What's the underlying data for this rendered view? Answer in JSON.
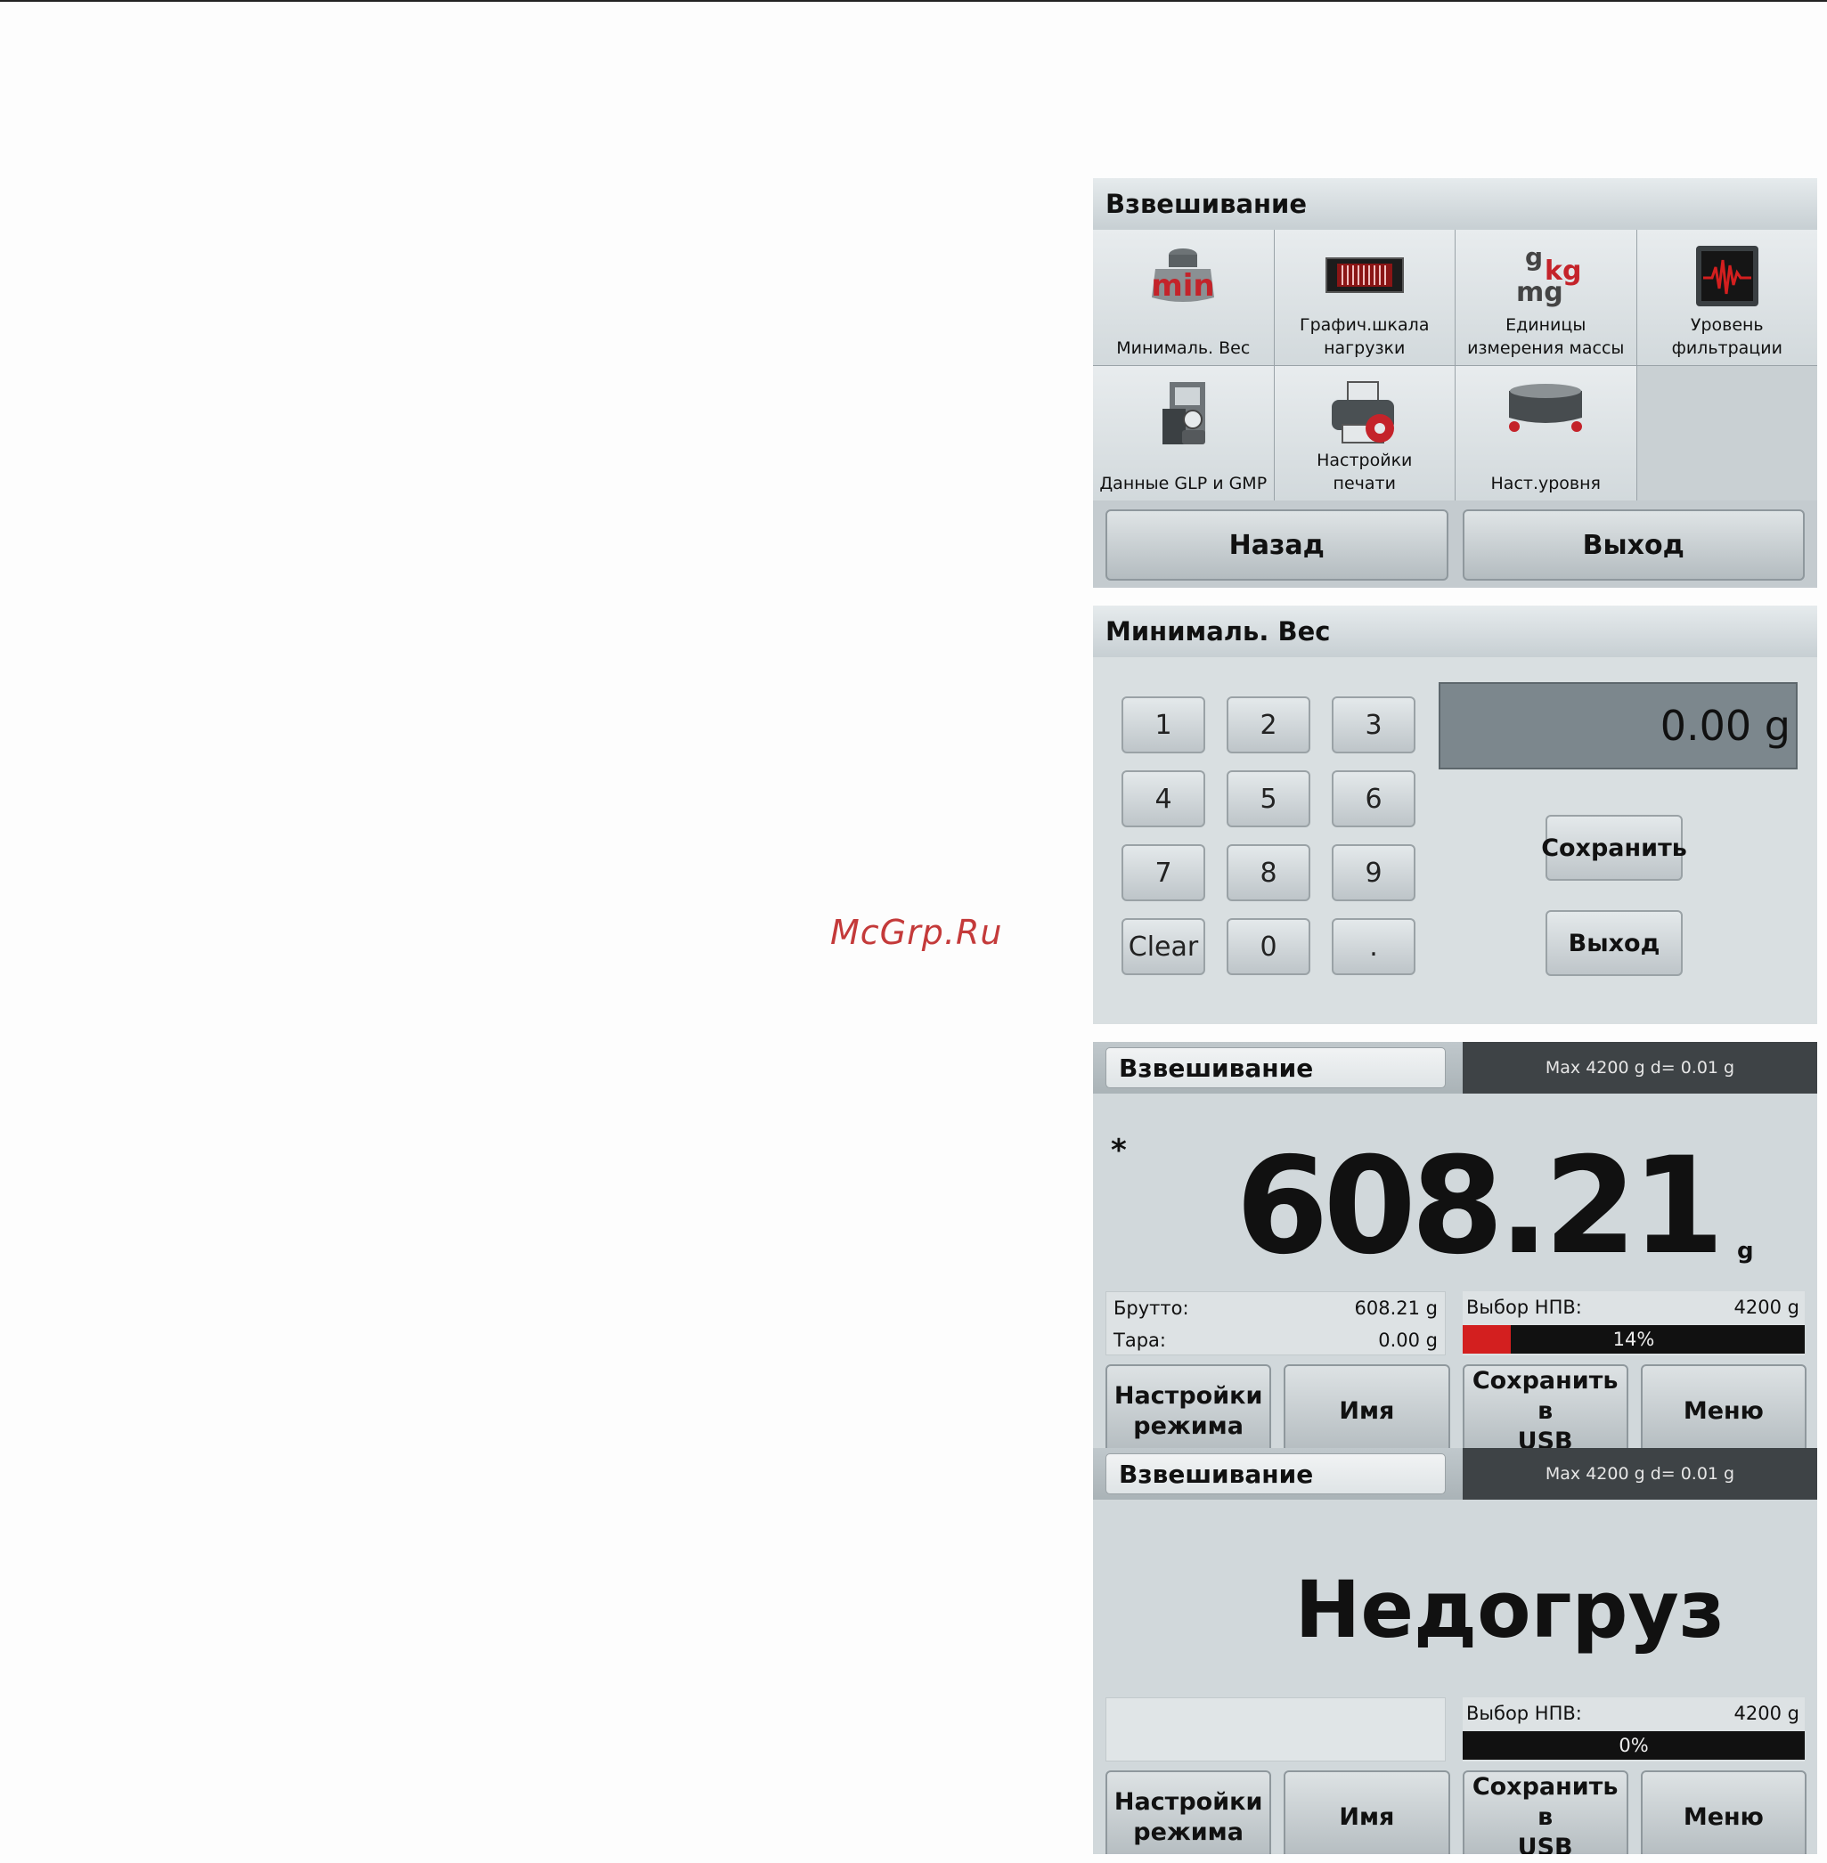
{
  "watermark": "McGrp.Ru",
  "menu_screen": {
    "title": "Взвешивание",
    "items": [
      {
        "label": "Минималь. Вес",
        "icon": "min-weight-icon"
      },
      {
        "label": "Графич.шкала\nнагрузки",
        "icon": "load-bar-icon"
      },
      {
        "label": "Единицы\nизмерения массы",
        "icon": "units-icon",
        "icon_text": [
          "g",
          "kg",
          "mg"
        ]
      },
      {
        "label": "Уровень\nфильтрации",
        "icon": "filter-level-icon"
      },
      {
        "label": "Данные GLP и GMP",
        "icon": "glp-gmp-icon"
      },
      {
        "label": "Настройки\nпечати",
        "icon": "print-settings-icon"
      },
      {
        "label": "Наст.уровня",
        "icon": "level-icon"
      }
    ],
    "back_label": "Назад",
    "exit_label": "Выход"
  },
  "keypad_screen": {
    "title": "Минималь. Вес",
    "keys": [
      "1",
      "2",
      "3",
      "4",
      "5",
      "6",
      "7",
      "8",
      "9",
      "Clear",
      "0",
      "."
    ],
    "display_value": "0.00 g",
    "save_label": "Сохранить",
    "exit_label": "Выход"
  },
  "home_screens": [
    {
      "app_name": "Взвешивание",
      "capacity": "Max 4200 g   d= 0.01 g",
      "stable_marker": "*",
      "reading": "608.21",
      "unit": "g",
      "status": "",
      "gross_label": "Брутто:",
      "gross_value": "608.21 g",
      "tare_label": "Тара:",
      "tare_value": "0.00 g",
      "npv_label": "Выбор НПВ:",
      "npv_value": "4200 g",
      "load_percent_text": "14%",
      "load_fraction": 0.14,
      "softkeys": [
        "Настройки\nрежима",
        "Имя",
        "Сохранить в\nUSB",
        "Меню"
      ]
    },
    {
      "app_name": "Взвешивание",
      "capacity": "Max 4200 g   d= 0.01 g",
      "status": "Недогруз",
      "npv_label": "Выбор НПВ:",
      "npv_value": "4200 g",
      "load_percent_text": "0%",
      "load_fraction": 0.0,
      "softkeys": [
        "Настройки\nрежима",
        "Имя",
        "Сохранить в\nUSB",
        "Меню"
      ]
    }
  ],
  "colors": {
    "brand_red": "#c4232a",
    "load_bar_fill": "#d31f1f",
    "capacity_bg": "#3e4346",
    "watermark": "#c43a3a"
  }
}
